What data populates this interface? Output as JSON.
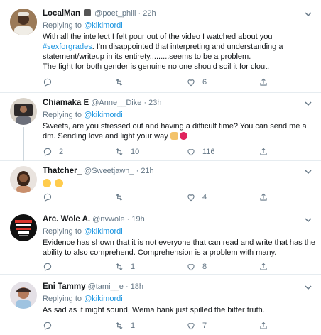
{
  "tweets": [
    {
      "name": "LocalMan",
      "name_badge": "🎩",
      "handle": "@poet_phill",
      "time": "22h",
      "reply_prefix": "Replying to",
      "reply_to": "@kikimordi",
      "text_before": "With all the intellect I felt pour out of the video I watched about you ",
      "hashtag": "#sexforgrades",
      "text_after": ". I'm disappointed that interpreting and understanding a statement/writeup in its entirety.........seems to be a problem.",
      "text_line2": "The fight for both gender is genuine no one should soil it for clout.",
      "replies": "",
      "retweets": "",
      "likes": "6"
    },
    {
      "name": "Chiamaka E",
      "handle": "@Anne__Dike",
      "time": "23h",
      "reply_prefix": "Replying to",
      "reply_to": "@kikimordi",
      "text": "Sweets, are you stressed out and having a difficult time? You can send me a dm. Sending love and light your way",
      "emoji": [
        "praying-hands-emoji",
        "heart-emoji"
      ],
      "replies": "2",
      "retweets": "10",
      "likes": "116"
    },
    {
      "name": "Thatcher_",
      "handle": "@Sweetjawn_",
      "time": "21h",
      "text_emoji": [
        "crying-laughing-emoji",
        "crying-laughing-emoji"
      ],
      "replies": "",
      "retweets": "",
      "likes": "4"
    },
    {
      "name": "Arc. Wole A.",
      "handle": "@nvwole",
      "time": "19h",
      "reply_prefix": "Replying to",
      "reply_to": "@kikimordi",
      "text": "Evidence has shown that it is not everyone that can read and write that has the ability to also comprehend. Comprehension is a  problem with many.",
      "replies": "",
      "retweets": "1",
      "likes": "8"
    },
    {
      "name": "Eni Tammy",
      "handle": "@tami__e",
      "time": "18h",
      "reply_prefix": "Replying to",
      "reply_to": "@kikimordi",
      "text": "As sad as it might sound, Wema bank just spilled the bitter truth.",
      "replies": "",
      "retweets": "1",
      "likes": "7"
    }
  ],
  "dot": "·",
  "colors": {
    "link": "#1b95e0",
    "muted": "#657786",
    "divider": "#e6ecf0"
  }
}
